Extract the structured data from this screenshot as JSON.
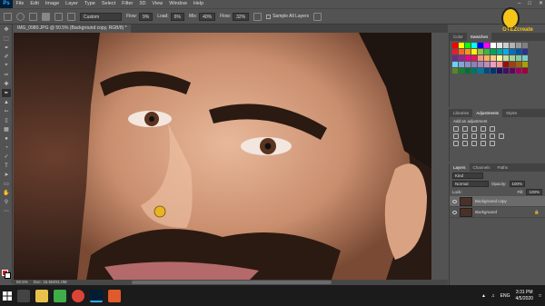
{
  "app": {
    "logo": "Ps"
  },
  "menu": [
    "File",
    "Edit",
    "Image",
    "Layer",
    "Type",
    "Select",
    "Filter",
    "3D",
    "View",
    "Window",
    "Help"
  ],
  "options": {
    "mode_label": "Mode:",
    "mode_value": "Custom",
    "mode_short": "Custom",
    "flow_label": "Flow:",
    "flow_value": "9%",
    "load_label": "Load:",
    "load_value": "6%",
    "mix_label": "Mix:",
    "mix_value": "40%",
    "flow2_label": "Flow:",
    "flow2_value": "32%",
    "sample_all": "Sample All Layers"
  },
  "document": {
    "tab_title": "IMG_0980.JPG @ 50.5% (Background copy, RGB/8) *",
    "zoom": "50.5%",
    "doc_info": "Doc: 15.5M/31.0M"
  },
  "logo": {
    "text": "OTEZcreate"
  },
  "swatches_panel": {
    "tabs": [
      "Color",
      "Swatches"
    ],
    "colors": [
      "#ff0000",
      "#ffff00",
      "#00ff00",
      "#00ffff",
      "#0000ff",
      "#ff00ff",
      "#ffffff",
      "#e6e6e6",
      "#cccccc",
      "#b3b3b3",
      "#999999",
      "#808080",
      "#ed1c24",
      "#f26522",
      "#f7941d",
      "#fff200",
      "#8dc63f",
      "#39b54a",
      "#00a651",
      "#00a99d",
      "#00aeef",
      "#0072bc",
      "#0054a6",
      "#2e3192",
      "#662d91",
      "#92278f",
      "#ec008c",
      "#ed145b",
      "#f69679",
      "#fbaf5d",
      "#fdc689",
      "#fff799",
      "#c4df9b",
      "#a3d39c",
      "#82ca9c",
      "#7accc8",
      "#6dcff6",
      "#7da7d8",
      "#8393ca",
      "#8781bd",
      "#a186be",
      "#bd8cbf",
      "#f49ac1",
      "#f5989d",
      "#9e0b0f",
      "#a0410d",
      "#a36209",
      "#aba000",
      "#598527",
      "#1a7b30",
      "#007236",
      "#00746b",
      "#0076a3",
      "#004b80",
      "#003471",
      "#1b1464",
      "#440e62",
      "#630460",
      "#9e005d",
      "#9e0039"
    ]
  },
  "adjustments_panel": {
    "tabs": [
      "Libraries",
      "Adjustments",
      "Styles"
    ],
    "title": "Add an adjustment"
  },
  "layers_panel": {
    "tabs": [
      "Layers",
      "Channels",
      "Paths"
    ],
    "kind": "Kind",
    "blend": "Normal",
    "opacity_label": "Opacity:",
    "opacity": "100%",
    "lock_label": "Lock:",
    "fill_label": "Fill:",
    "fill": "100%",
    "layers": [
      {
        "name": "Background copy",
        "selected": true
      },
      {
        "name": "Background",
        "selected": false
      }
    ]
  },
  "taskbar": {
    "lang": "ENG",
    "time": "3:31 PM",
    "date": "4/5/2020"
  },
  "colors": {
    "brush_cursor": "#e8b520"
  }
}
